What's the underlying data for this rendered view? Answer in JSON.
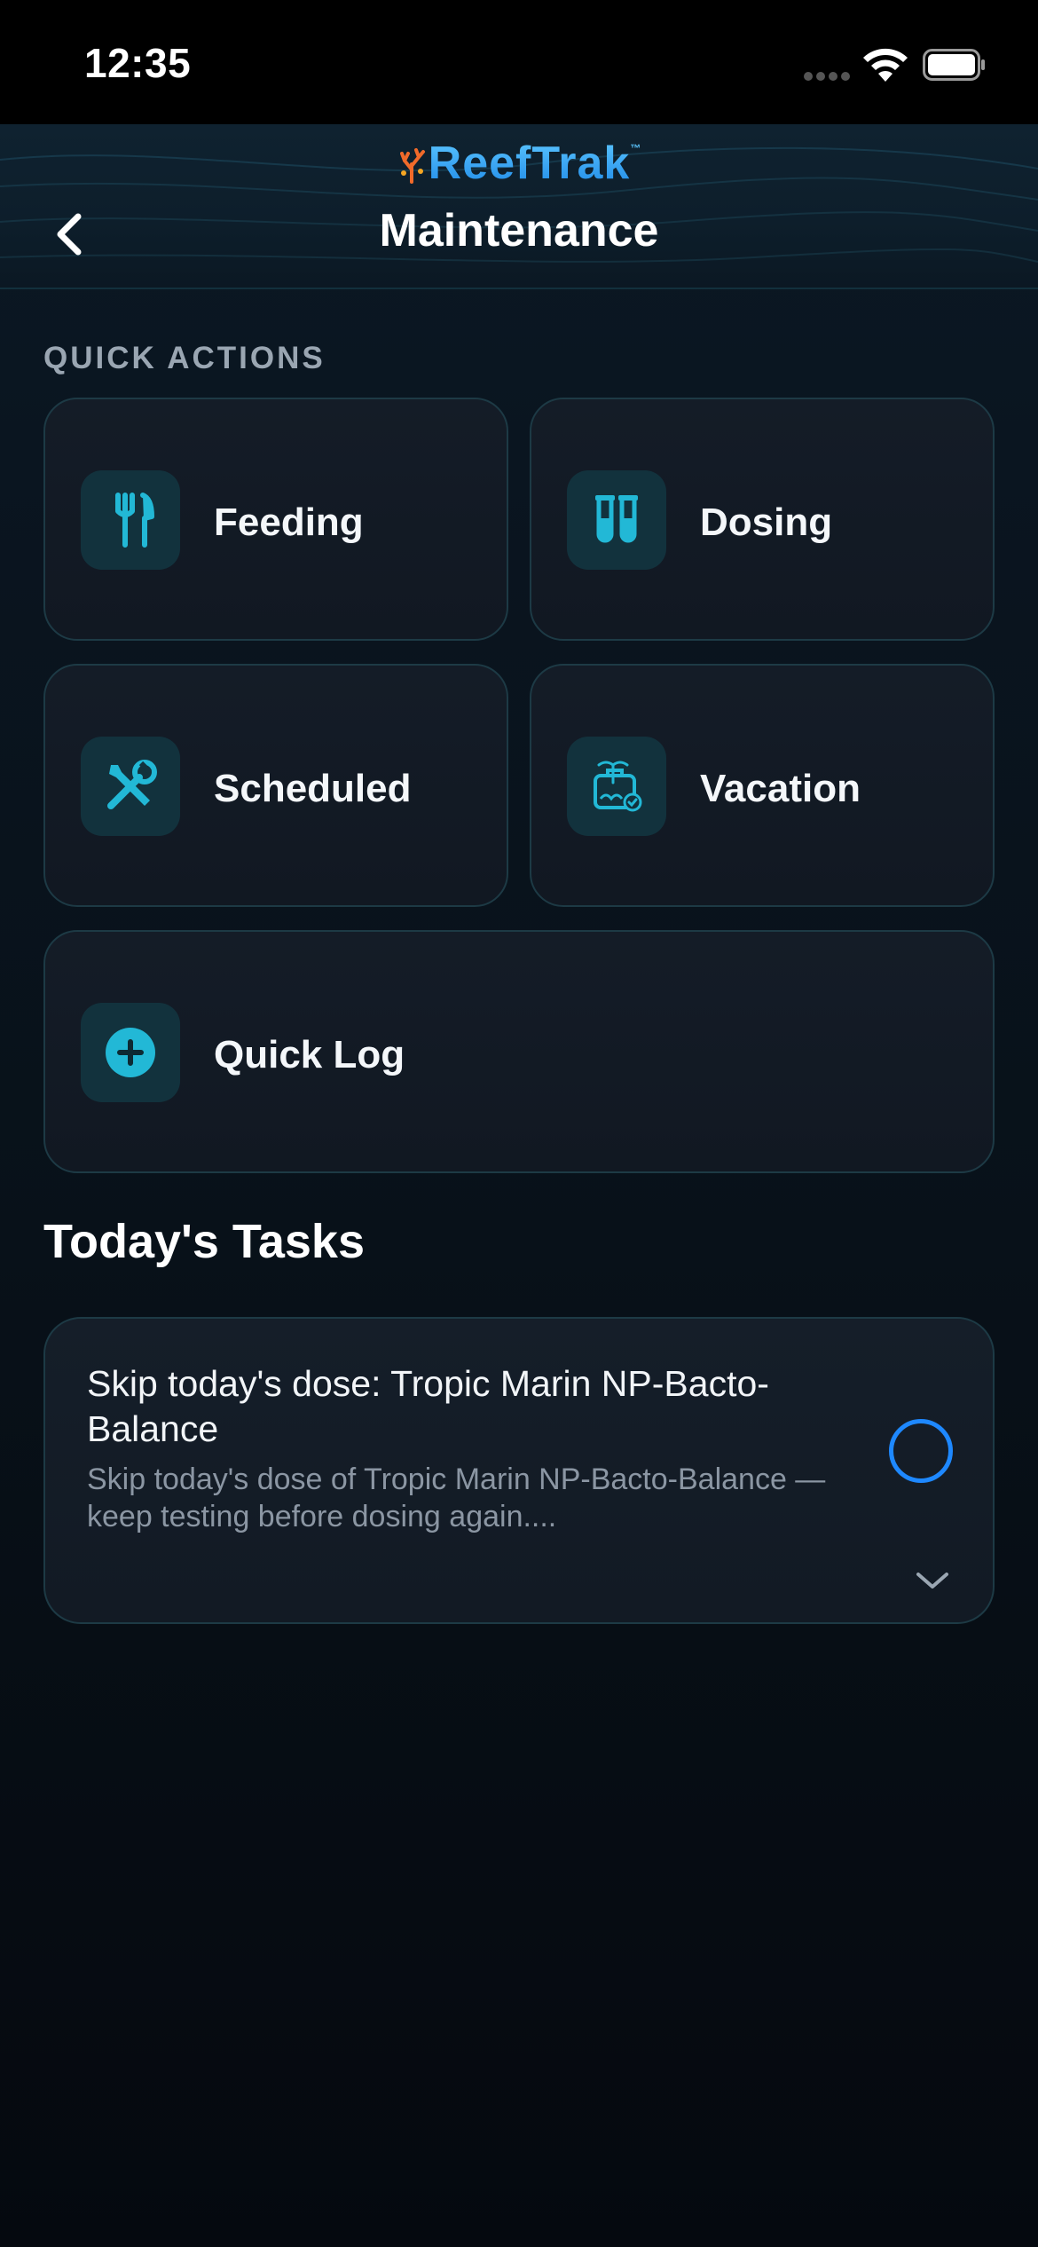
{
  "status_bar": {
    "time": "12:35"
  },
  "header": {
    "brand": "ReefTrak",
    "brand_tm": "™",
    "title": "Maintenance"
  },
  "quick_actions": {
    "label": "QUICK ACTIONS",
    "items": [
      {
        "label": "Feeding",
        "icon": "utensils-icon"
      },
      {
        "label": "Dosing",
        "icon": "test-tubes-icon"
      },
      {
        "label": "Scheduled",
        "icon": "tools-icon"
      },
      {
        "label": "Vacation",
        "icon": "vacation-icon"
      },
      {
        "label": "Quick Log",
        "icon": "plus-circle-icon"
      }
    ]
  },
  "tasks": {
    "title": "Today's Tasks",
    "items": [
      {
        "title": "Skip today's dose: Tropic Marin NP-Bacto-Balance",
        "description": "Skip today's dose of Tropic Marin NP-Bacto-Balance — keep testing before dosing again....",
        "completed": false
      }
    ]
  },
  "colors": {
    "accent": "#1fb3d2",
    "brand_blue": "#2a9cf0",
    "check_blue": "#1e88ff",
    "background": "#0a1520"
  }
}
